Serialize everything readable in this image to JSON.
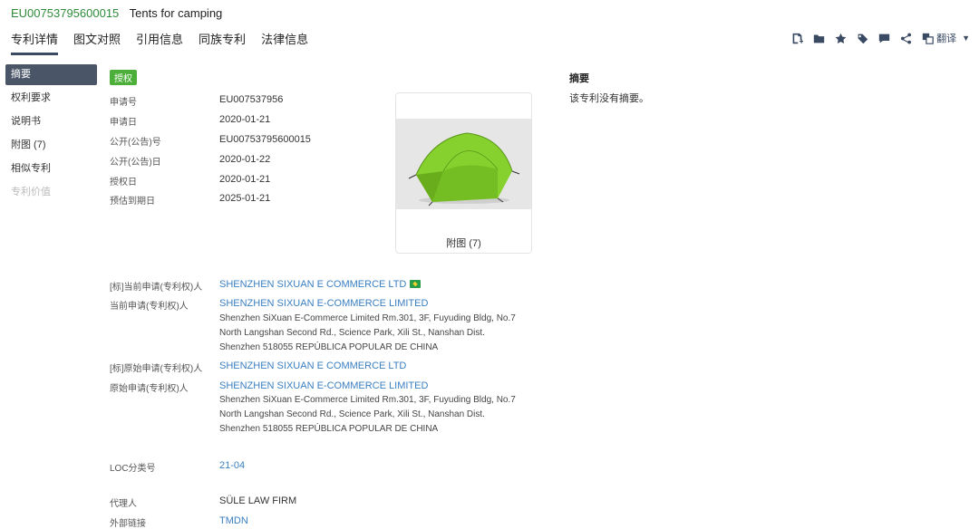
{
  "header": {
    "patent_number": "EU00753795600015",
    "title": "Tents for camping"
  },
  "tabs": [
    "专利详情",
    "图文对照",
    "引用信息",
    "同族专利",
    "法律信息"
  ],
  "toolbar": {
    "translate_label": "翻译",
    "icons": [
      "add-note-icon",
      "folder-icon",
      "star-icon",
      "tag-icon",
      "comment-icon",
      "share-icon"
    ]
  },
  "sidebar": {
    "items": [
      {
        "label": "摘要"
      },
      {
        "label": "权利要求"
      },
      {
        "label": "说明书"
      },
      {
        "label": "附图 (7)"
      },
      {
        "label": "相似专利"
      },
      {
        "label": "专利价值"
      }
    ]
  },
  "status_badge": "授权",
  "fields": {
    "application_no": {
      "label": "申请号",
      "value": "EU007537956"
    },
    "application_date": {
      "label": "申请日",
      "value": "2020-01-21"
    },
    "publication_no": {
      "label": "公开(公告)号",
      "value": "EU00753795600015"
    },
    "publication_date": {
      "label": "公开(公告)日",
      "value": "2020-01-22"
    },
    "grant_date": {
      "label": "授权日",
      "value": "2020-01-21"
    },
    "expiry_date": {
      "label": "预估到期日",
      "value": "2025-01-21"
    },
    "std_current_applicant": {
      "label": "[标]当前申请(专利权)人",
      "value": "SHENZHEN SIXUAN E COMMERCE LTD"
    },
    "current_applicant": {
      "label": "当前申请(专利权)人",
      "value": "SHENZHEN SIXUAN E-COMMERCE LIMITED",
      "address": [
        "Shenzhen SiXuan E-Commerce Limited Rm.301, 3F, Fuyuding Bldg, No.7",
        "North Langshan Second Rd., Science Park, Xili St., Nanshan Dist.",
        "Shenzhen 518055 REPÚBLICA POPULAR DE CHINA"
      ]
    },
    "std_original_applicant": {
      "label": "[标]原始申请(专利权)人",
      "value": "SHENZHEN SIXUAN E COMMERCE LTD"
    },
    "original_applicant": {
      "label": "原始申请(专利权)人",
      "value": "SHENZHEN SIXUAN E-COMMERCE LIMITED",
      "address": [
        "Shenzhen SiXuan E-Commerce Limited Rm.301, 3F, Fuyuding Bldg, No.7",
        "North Langshan Second Rd., Science Park, Xili St., Nanshan Dist.",
        "Shenzhen 518055 REPÚBLICA POPULAR DE CHINA"
      ]
    },
    "loc_class": {
      "label": "LOC分类号",
      "value": "21-04"
    },
    "agent": {
      "label": "代理人",
      "value": "SÜLE LAW FIRM"
    },
    "external_link": {
      "label": "外部链接",
      "value": "TMDN"
    }
  },
  "figure": {
    "caption": "附图 (7)"
  },
  "abstract": {
    "title": "摘要",
    "text": "该专利没有摘要。"
  },
  "colors": {
    "accent": "#3a4a63",
    "link": "#3a7fc1",
    "badge": "#4caf3a",
    "tent": "#7ed321"
  }
}
